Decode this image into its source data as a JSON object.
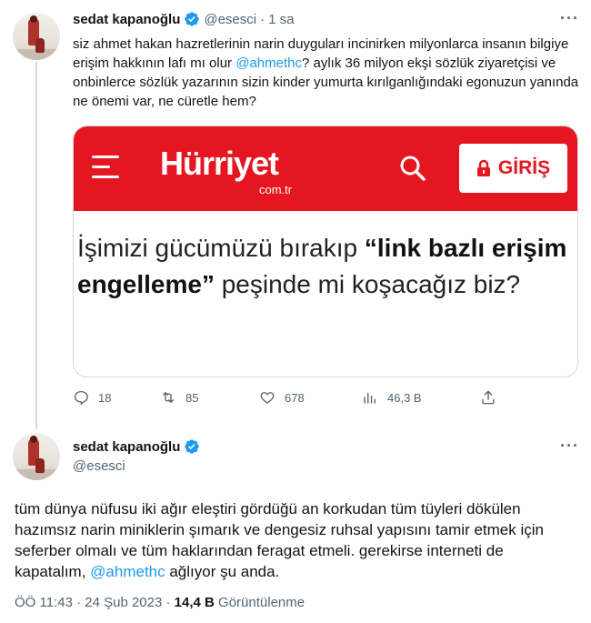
{
  "tweet1": {
    "author_name": "sedat kapanoğlu",
    "handle": "@esesci",
    "separator": "·",
    "time": "1 sa",
    "more_label": "···",
    "text_part1": "siz ahmet hakan hazretlerinin narin duyguları incinirken milyonlarca insanın bilgiye erişim hakkının lafı mı olur ",
    "mention": "@ahmethc",
    "text_part2": "? aylık 36 milyon ekşi sözlük ziyaretçisi ve onbinlerce sözlük yazarının sizin kinder yumurta kırılganlığındaki egonuzun yanında ne önemi var, ne cüretle hem?"
  },
  "card": {
    "logo_text": "Hürriyet",
    "logo_sub": "com.tr",
    "login_label": "GİRİŞ",
    "body_part1": "İşimizi gücümüzü bırakıp ",
    "body_bold1": "“link bazlı erişim engelleme”",
    "body_part2": " peşinde mi koşacağız biz?",
    "brand_color": "#e5161f"
  },
  "actions": {
    "replies": "18",
    "retweets": "85",
    "likes": "678",
    "views": "46,3 B"
  },
  "tweet2": {
    "author_name": "sedat kapanoğlu",
    "handle": "@esesci",
    "more_label": "···",
    "text_part1": "tüm dünya nüfusu iki ağır eleştiri gördüğü an korkudan tüm tüyleri dökülen hazımsız narin miniklerin şımarık ve dengesiz ruhsal yapısını tamir etmek için seferber olmalı ve tüm haklarından feragat etmeli. gerekirse interneti de kapatalım, ",
    "mention": "@ahmethc",
    "text_part2": " ağlıyor şu anda.",
    "timestamp": "ÖÖ 11:43 · 24 Şub 2023 · ",
    "views_count": "14,4 B",
    "views_label": " Görüntülenme"
  }
}
